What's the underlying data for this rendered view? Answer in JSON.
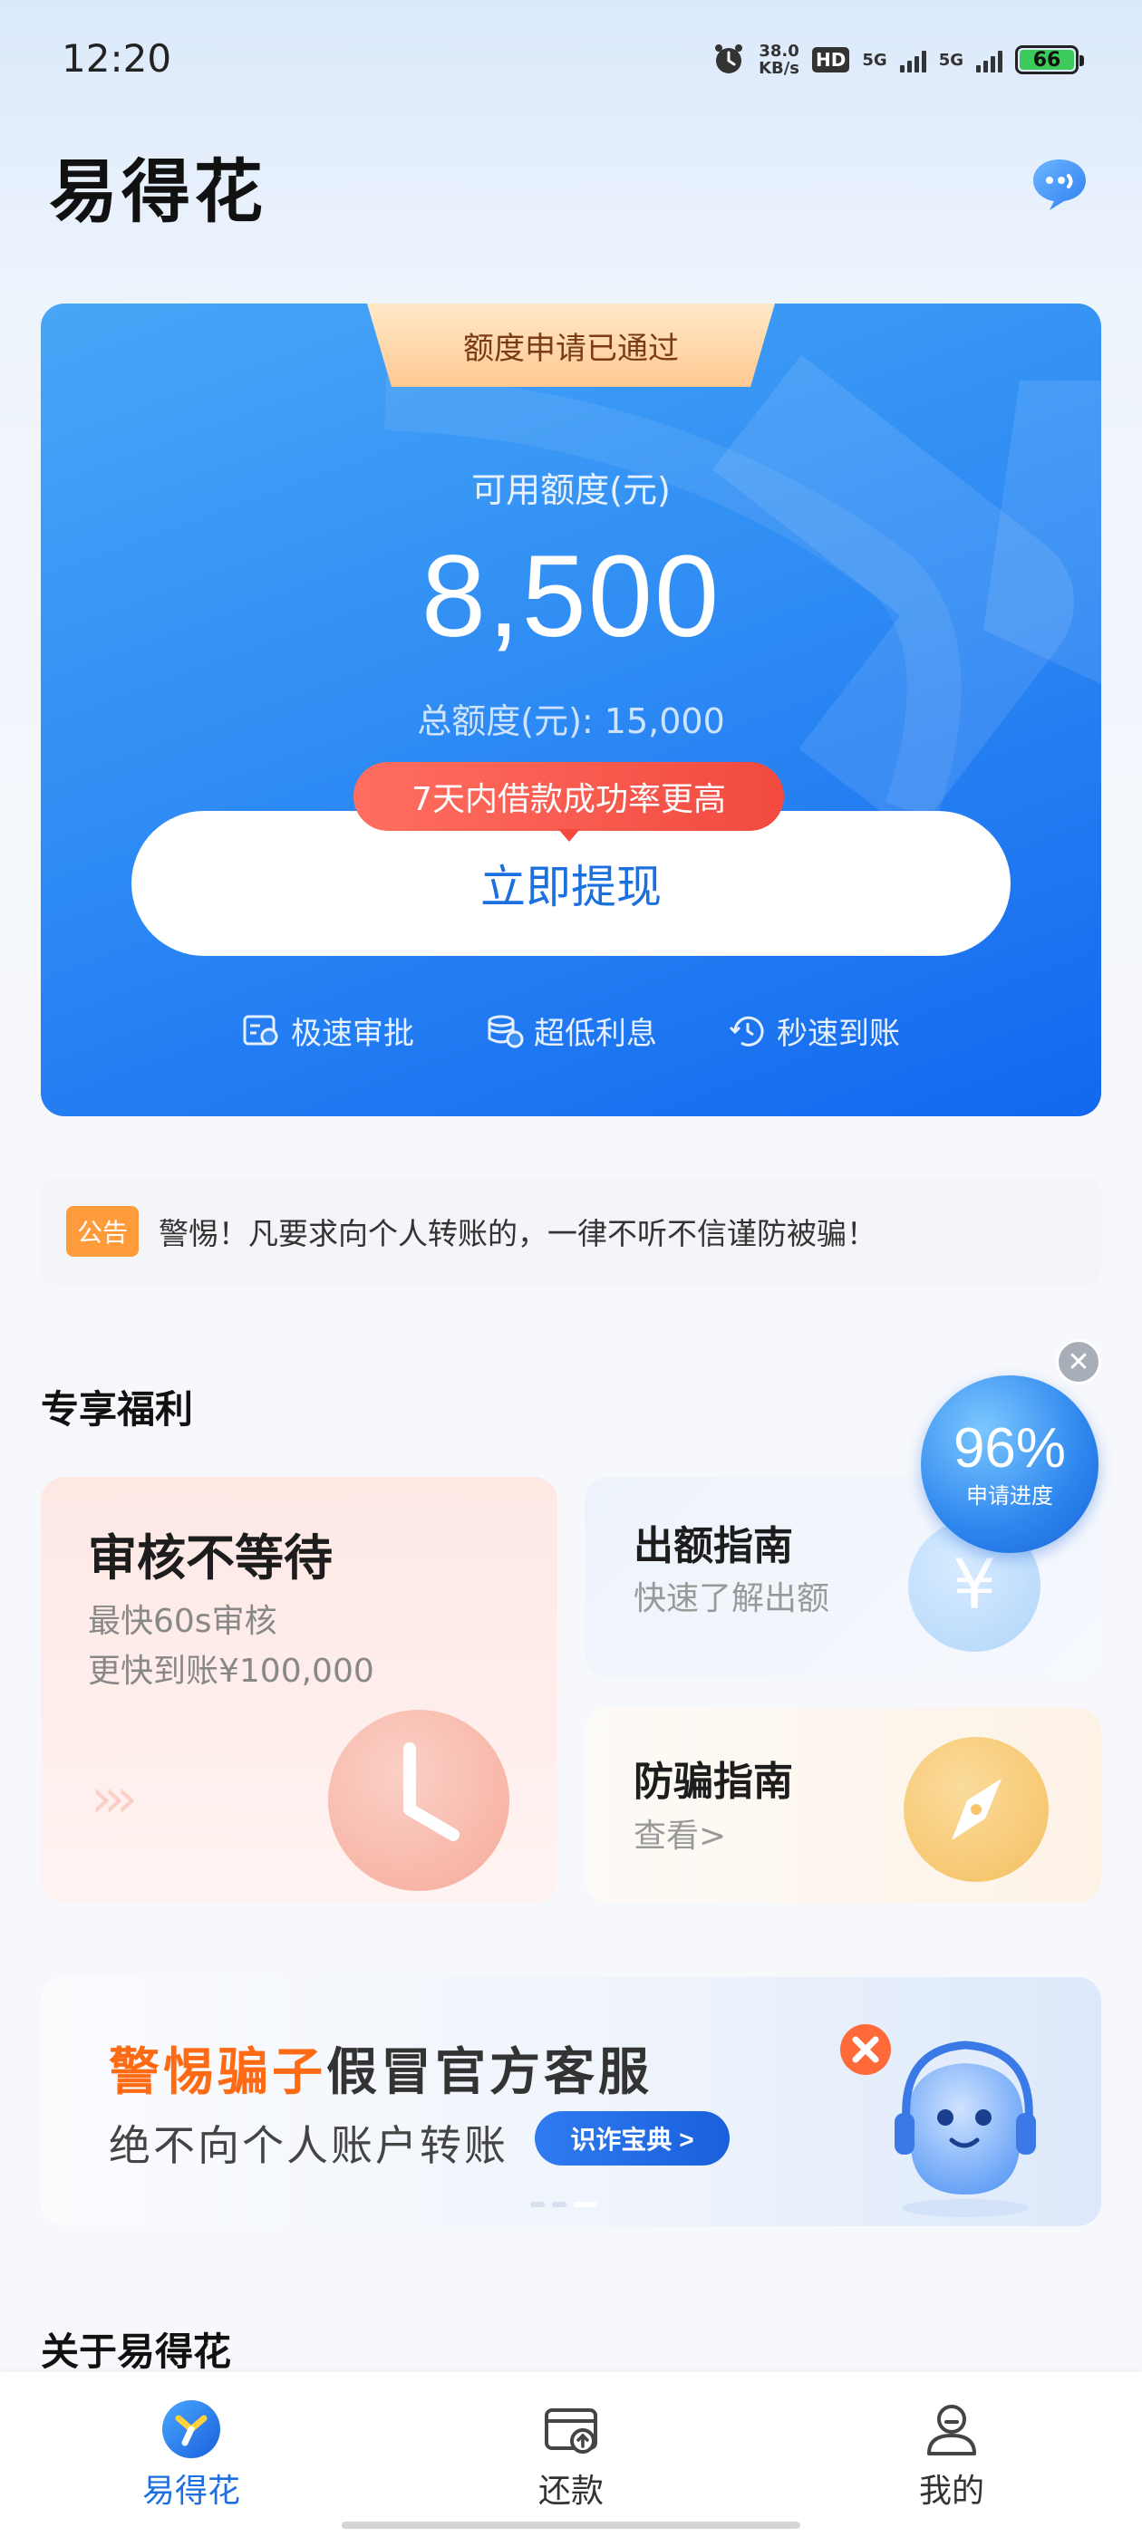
{
  "status_bar": {
    "time": "12:20",
    "net_speed_value": "38.0",
    "net_speed_unit": "KB/s",
    "hd_label": "HD",
    "net1": "5G",
    "net2": "5G",
    "battery": "66"
  },
  "header": {
    "app_title": "易得花",
    "service_icon": "chat-bubble-icon"
  },
  "credit_card": {
    "status_ribbon": "额度申请已通过",
    "available_label": "可用额度(元)",
    "available_amount": "8,500",
    "total_line": "总额度(元): 15,000",
    "promo_tag": "7天内借款成功率更高",
    "withdraw_button": "立即提现",
    "features": [
      {
        "label": "极速审批",
        "icon": "approval-icon"
      },
      {
        "label": "超低利息",
        "icon": "coins-icon"
      },
      {
        "label": "秒速到账",
        "icon": "clock-arrow-icon"
      }
    ]
  },
  "notice": {
    "tag": "公告",
    "text": "警惕！凡要求向个人转账的，一律不听不信谨防被骗！"
  },
  "benefits": {
    "title": "专享福利",
    "progress": {
      "percent": "96%",
      "label": "申请进度",
      "close": "✕"
    },
    "review_card": {
      "title": "审核不等待",
      "line1": "最快60s审核",
      "line2": "更快到账¥100,000",
      "arrows": "›››"
    },
    "quota_card": {
      "title": "出额指南",
      "subtitle": "快速了解出额",
      "icon_glyph": "¥"
    },
    "fraud_card": {
      "title": "防骗指南",
      "subtitle": "查看>"
    }
  },
  "banner": {
    "emphasis": "警惕骗子",
    "rest": "假冒官方客服",
    "line2": "绝不向个人账户转账",
    "button": "识诈宝典 >"
  },
  "about": {
    "title": "关于易得花"
  },
  "tab_bar": {
    "tabs": [
      {
        "label": "易得花",
        "icon": "home-logo-icon",
        "active": true
      },
      {
        "label": "还款",
        "icon": "repay-icon",
        "active": false
      },
      {
        "label": "我的",
        "icon": "profile-icon",
        "active": false
      }
    ]
  },
  "colors": {
    "primary_blue": "#1e6fe0",
    "card_gradient_start": "#48a6f7",
    "card_gradient_end": "#1368ef",
    "promo_red": "#f24a40",
    "notice_orange": "#ff9b3b",
    "banner_orange": "#ff6a14"
  }
}
